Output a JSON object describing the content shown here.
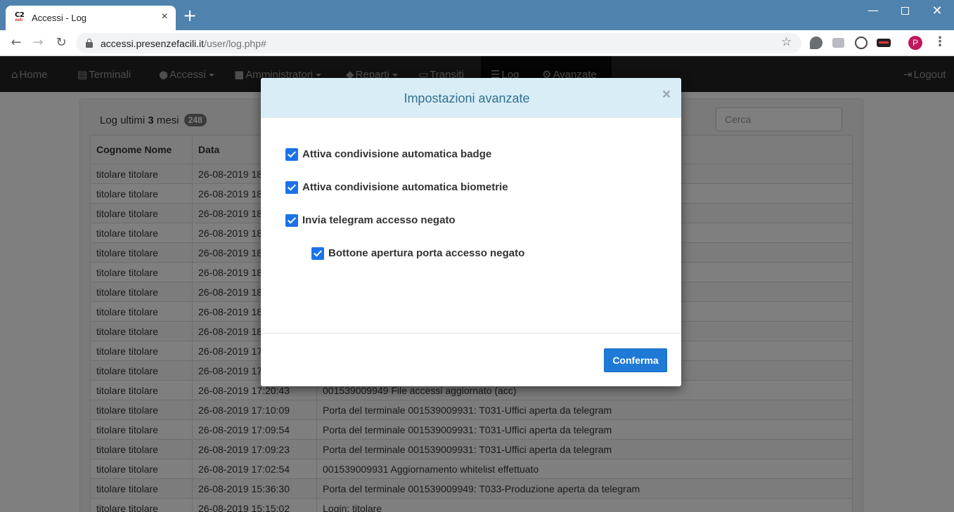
{
  "browser": {
    "tab_title": "Accessi - Log",
    "favicon_text": "C2",
    "favicon_sub": "web",
    "url_host": "accessi.presenzefacili.it",
    "url_path": "/user/log.php#",
    "avatar_letter": "P"
  },
  "nav": {
    "home": "Home",
    "terminali": "Terminali",
    "accessi": "Accessi",
    "amministratori": "Amministratori",
    "reparti": "Reparti",
    "transiti": "Transiti",
    "log": "Log",
    "avanzate": "Avanzate",
    "logout": "Logout"
  },
  "log": {
    "title_prefix": "Log ultimi",
    "months": "3",
    "title_suffix": "mesi",
    "count": "248",
    "search_placeholder": "Cerca",
    "columns": [
      "Cognome Nome",
      "Data",
      ""
    ],
    "rows": [
      [
        "titolare titolare",
        "26-08-2019 18",
        ""
      ],
      [
        "titolare titolare",
        "26-08-2019 18",
        ""
      ],
      [
        "titolare titolare",
        "26-08-2019 18",
        ""
      ],
      [
        "titolare titolare",
        "26-08-2019 18",
        ""
      ],
      [
        "titolare titolare",
        "26-08-2019 18",
        ""
      ],
      [
        "titolare titolare",
        "26-08-2019 18",
        ""
      ],
      [
        "titolare titolare",
        "26-08-2019 18",
        ""
      ],
      [
        "titolare titolare",
        "26-08-2019 18",
        ""
      ],
      [
        "titolare titolare",
        "26-08-2019 18",
        ""
      ],
      [
        "titolare titolare",
        "26-08-2019 17",
        ""
      ],
      [
        "titolare titolare",
        "26-08-2019 17",
        ""
      ],
      [
        "titolare titolare",
        "26-08-2019 17:20:43",
        "001539009949 File accessi aggiornato (acc)"
      ],
      [
        "titolare titolare",
        "26-08-2019 17:10:09",
        "Porta del terminale 001539009931: T031-Uffici aperta da telegram"
      ],
      [
        "titolare titolare",
        "26-08-2019 17:09:54",
        "Porta del terminale 001539009931: T031-Uffici aperta da telegram"
      ],
      [
        "titolare titolare",
        "26-08-2019 17:09:23",
        "Porta del terminale 001539009931: T031-Uffici aperta da telegram"
      ],
      [
        "titolare titolare",
        "26-08-2019 17:02:54",
        "001539009931 Aggiornamento whitelist effettuato"
      ],
      [
        "titolare titolare",
        "26-08-2019 15:36:30",
        "Porta del terminale 001539009949: T033-Produzione aperta da telegram"
      ],
      [
        "titolare titolare",
        "26-08-2019 15:15:02",
        "Login: titolare"
      ]
    ]
  },
  "modal": {
    "title": "Impostazioni avanzate",
    "close": "×",
    "options": [
      {
        "label": "Attiva condivisione automatica badge",
        "checked": true
      },
      {
        "label": "Attiva condivisione automatica biometrie",
        "checked": true
      },
      {
        "label": "Invia telegram accesso negato",
        "checked": true
      },
      {
        "label": "Bottone apertura porta accesso negato",
        "checked": true
      }
    ],
    "confirm": "Conferma"
  }
}
